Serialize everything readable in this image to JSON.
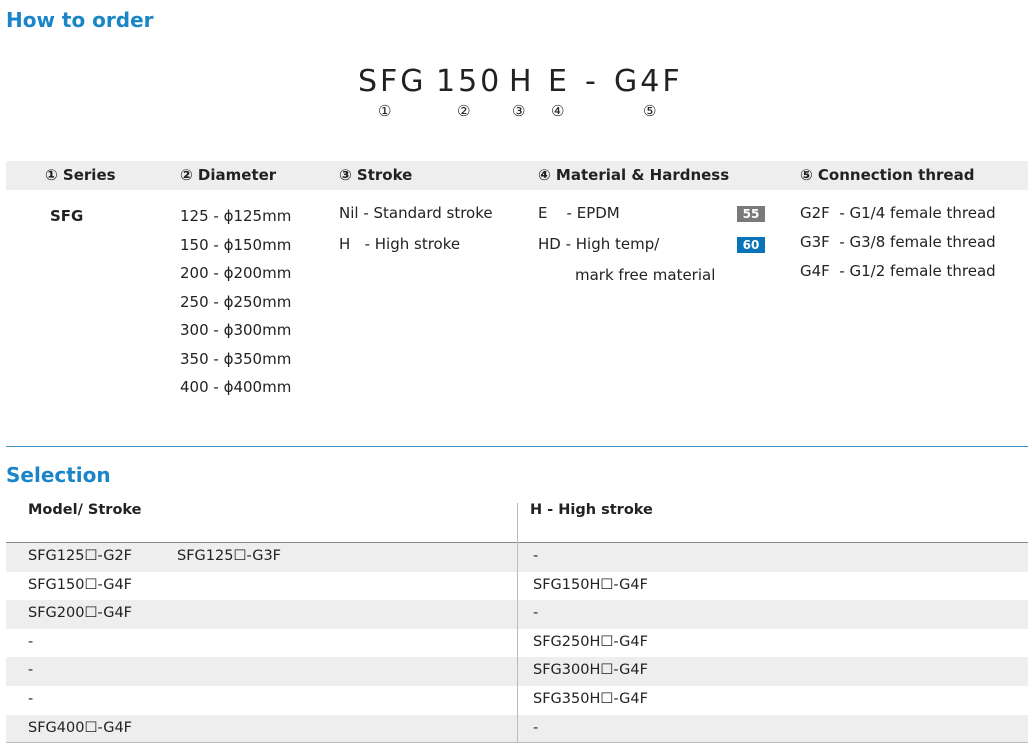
{
  "order": {
    "title": "How to order",
    "code": [
      "SFG",
      "150",
      "H",
      "E",
      "-",
      "G4F"
    ],
    "markers": [
      "①",
      "②",
      "③",
      "④",
      "⑤"
    ],
    "headers": [
      "① Series",
      "② Diameter",
      "③ Stroke",
      "④ Material & Hardness",
      "⑤ Connection thread"
    ],
    "series": [
      "SFG"
    ],
    "diameters": [
      "125 - ϕ125mm",
      "150 - ϕ150mm",
      "200 - ϕ200mm",
      "250 - ϕ250mm",
      "300 - ϕ300mm",
      "350 - ϕ350mm",
      "400 - ϕ400mm"
    ],
    "strokes": [
      "Nil - Standard stroke",
      "H   - High stroke"
    ],
    "materials": [
      {
        "label": "E    - EPDM",
        "badge": "55",
        "color": "#7a7a7a"
      },
      {
        "label": "HD - High temp/",
        "badge": "60",
        "color": "#0a74b8"
      }
    ],
    "material_cont": "mark free material",
    "threads": [
      "G2F  - G1/4 female thread",
      "G3F  - G3/8 female thread",
      "G4F  - G1/2 female thread"
    ]
  },
  "selection": {
    "title": "Selection",
    "headers": [
      "Model/ Stroke",
      "H - High stroke"
    ],
    "rows": [
      {
        "a": "SFG125☐-G2F",
        "b": "SFG125☐-G3F",
        "h": "-"
      },
      {
        "a": "SFG150☐-G4F",
        "b": "",
        "h": "SFG150H☐-G4F"
      },
      {
        "a": "SFG200☐-G4F",
        "b": "",
        "h": "-"
      },
      {
        "a": "-",
        "b": "",
        "h": "SFG250H☐-G4F"
      },
      {
        "a": "-",
        "b": "",
        "h": "SFG300H☐-G4F"
      },
      {
        "a": "-",
        "b": "",
        "h": "SFG350H☐-G4F"
      },
      {
        "a": "SFG400☐-G4F",
        "b": "",
        "h": "-"
      }
    ]
  }
}
